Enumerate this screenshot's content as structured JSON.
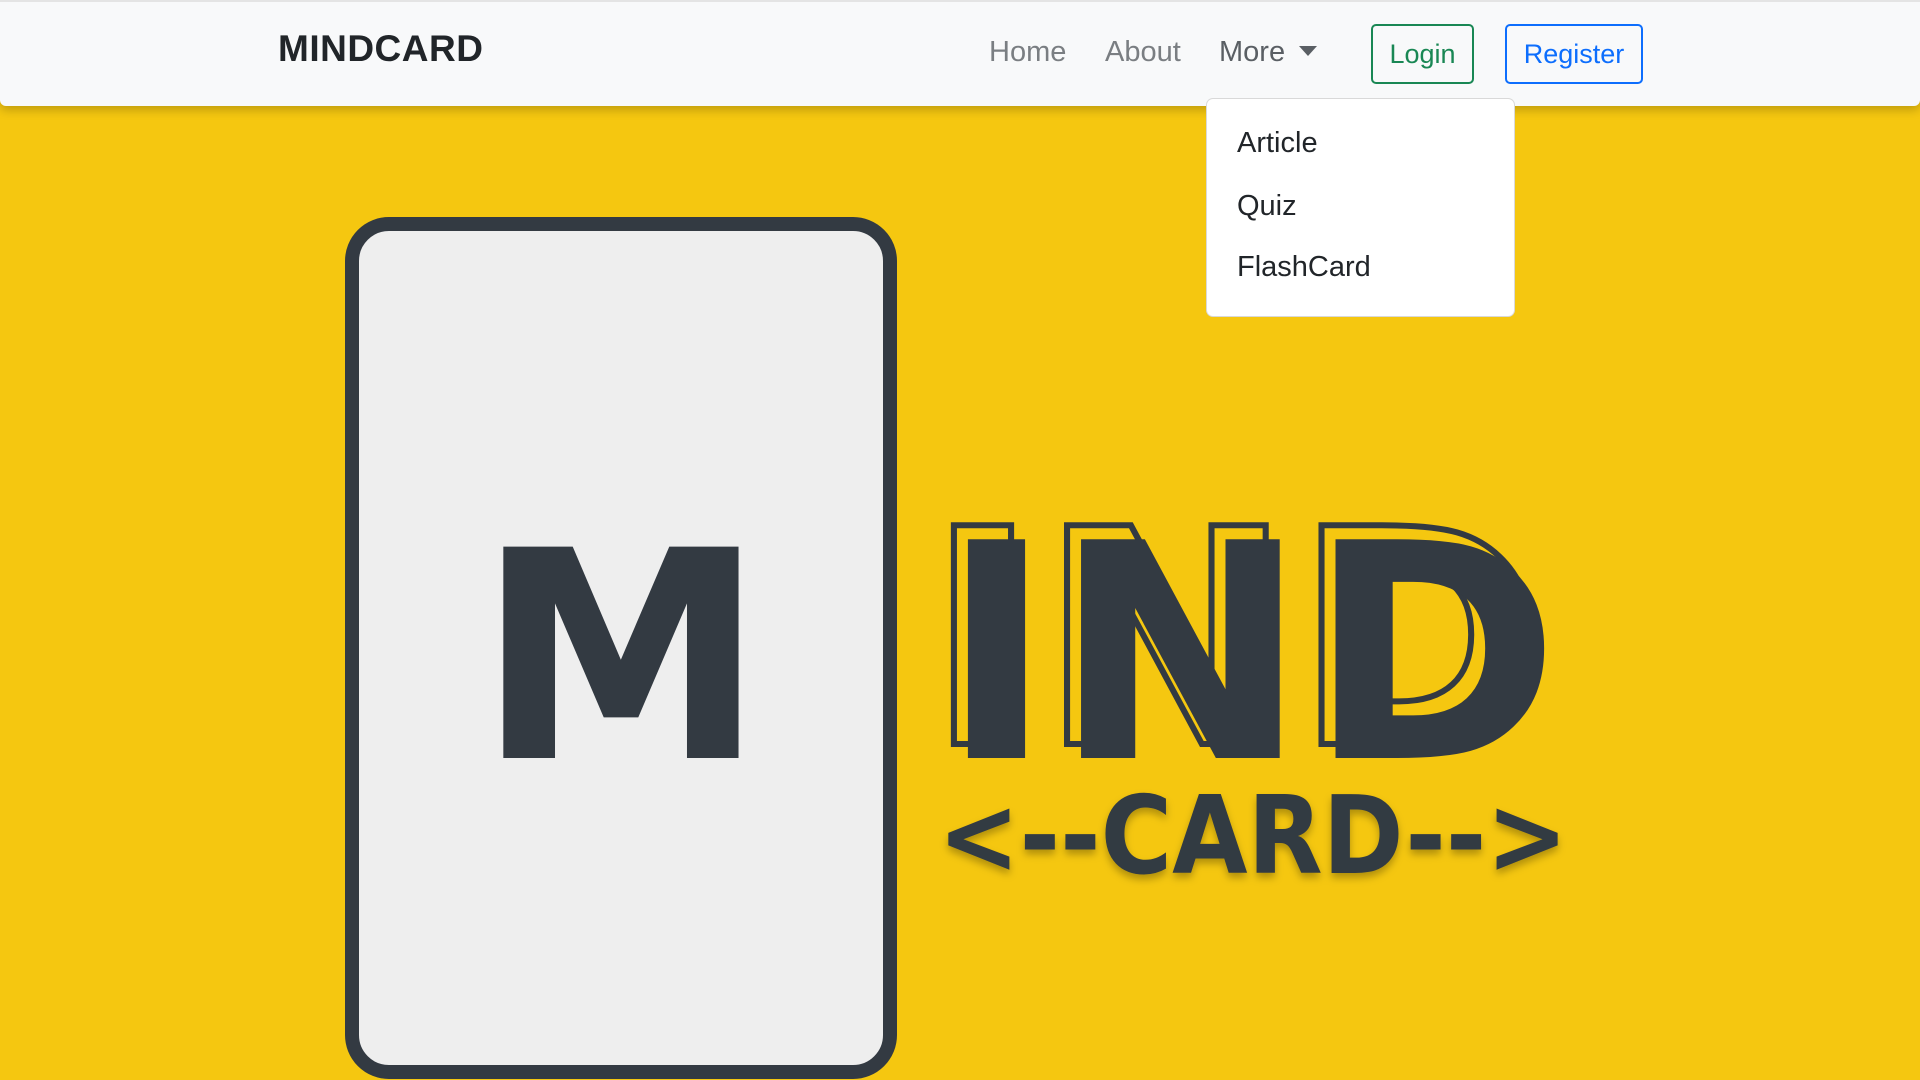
{
  "navbar": {
    "brand": "MINDCARD",
    "links": [
      {
        "label": "Home"
      },
      {
        "label": "About"
      },
      {
        "label": "More"
      }
    ],
    "login_label": "Login",
    "register_label": "Register"
  },
  "dropdown": {
    "items": [
      {
        "label": "Article"
      },
      {
        "label": "Quiz"
      },
      {
        "label": "FlashCard"
      }
    ]
  },
  "hero": {
    "card_letter": "M",
    "title_rest": "IND",
    "subtitle": "<--CARD-->"
  },
  "colors": {
    "background": "#f5c710",
    "navbar": "#f8f9fa",
    "logo_dark": "#333a42",
    "card_fill": "#eeeeee",
    "login": "#198754",
    "register": "#0d6efd"
  }
}
